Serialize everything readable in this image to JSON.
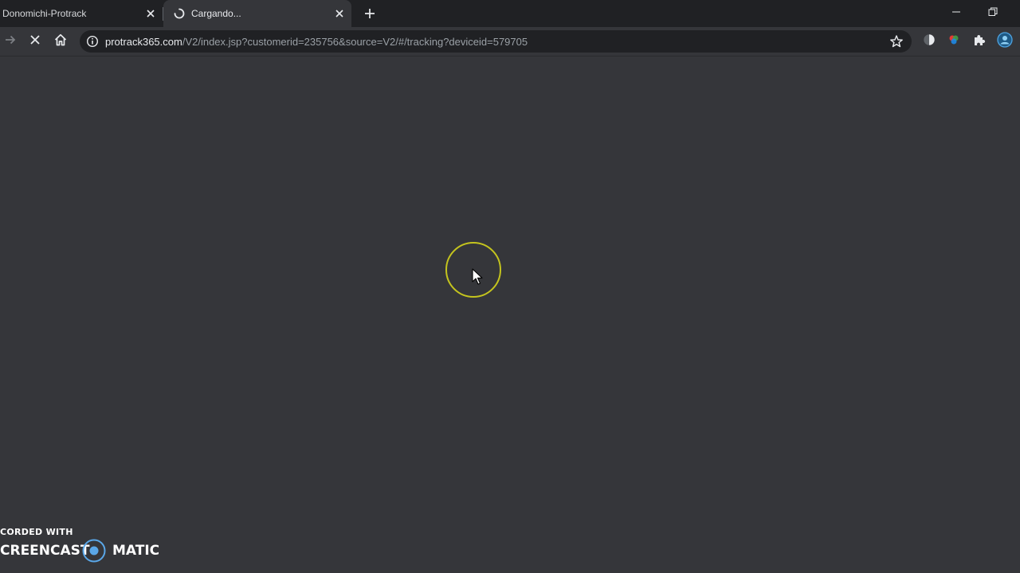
{
  "tabs": [
    {
      "title": "Donomichi-Protrack",
      "active": false
    },
    {
      "title": "Cargando...",
      "active": true
    }
  ],
  "address_bar": {
    "host": "protrack365.com",
    "path": "/V2/index.jsp?customerid=235756&source=V2/#/tracking?deviceid=579705"
  },
  "watermark": {
    "line1": "CORDED WITH",
    "left_text": "CREENCAST",
    "right_text": "MATIC"
  },
  "colors": {
    "tabstrip_bg": "#202124",
    "page_bg": "#35363a",
    "cursor_ring": "#c4c41e",
    "watermark_accent": "#4a90d9"
  },
  "icons": {
    "back": "arrow-right-icon",
    "stop": "close-icon",
    "home": "home-icon",
    "info": "info-icon",
    "bookmark": "star-icon",
    "extensions": "puzzle-icon"
  }
}
